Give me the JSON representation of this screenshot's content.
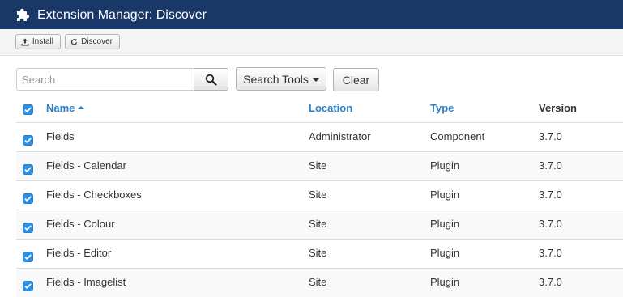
{
  "header": {
    "title": "Extension Manager: Discover",
    "icon": "puzzle-piece-icon",
    "bg_color": "#1a3867"
  },
  "toolbar": {
    "install_label": "Install",
    "discover_label": "Discover"
  },
  "filter": {
    "search_placeholder": "Search",
    "search_value": "",
    "search_tools_label": "Search Tools",
    "clear_label": "Clear"
  },
  "table": {
    "columns": {
      "name": "Name",
      "location": "Location",
      "type": "Type",
      "version": "Version"
    },
    "sorted_by": "Name",
    "sort_direction": "ascending",
    "rows": [
      {
        "name": "Fields",
        "location": "Administrator",
        "type": "Component",
        "version": "3.7.0",
        "checked": true
      },
      {
        "name": "Fields - Calendar",
        "location": "Site",
        "type": "Plugin",
        "version": "3.7.0",
        "checked": true
      },
      {
        "name": "Fields - Checkboxes",
        "location": "Site",
        "type": "Plugin",
        "version": "3.7.0",
        "checked": true
      },
      {
        "name": "Fields - Colour",
        "location": "Site",
        "type": "Plugin",
        "version": "3.7.0",
        "checked": true
      },
      {
        "name": "Fields - Editor",
        "location": "Site",
        "type": "Plugin",
        "version": "3.7.0",
        "checked": true
      },
      {
        "name": "Fields - Imagelist",
        "location": "Site",
        "type": "Plugin",
        "version": "3.7.0",
        "checked": true
      }
    ]
  },
  "colors": {
    "link": "#2a7fc6",
    "checkbox": "#2f8fe0"
  }
}
